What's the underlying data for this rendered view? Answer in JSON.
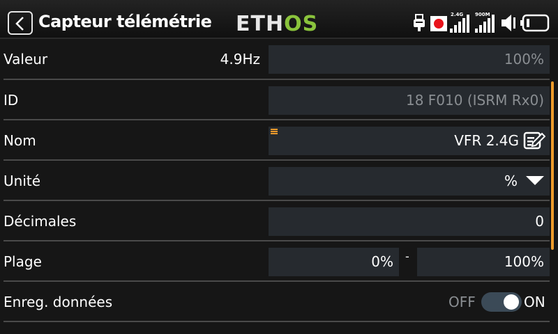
{
  "header": {
    "title": "Capteur télémétrie",
    "logo_part1": "ETH",
    "logo_part2": "OS",
    "signal_2g4": "2.4G",
    "signal_900m": "900M"
  },
  "rows": {
    "valeur": {
      "label": "Valeur",
      "rate": "4.9Hz",
      "value": "100%"
    },
    "id": {
      "label": "ID",
      "value": "18 F010 (ISRM Rx0)"
    },
    "nom": {
      "label": "Nom",
      "value": "VFR 2.4G"
    },
    "unite": {
      "label": "Unité",
      "value": "%"
    },
    "decimales": {
      "label": "Décimales",
      "value": "0"
    },
    "plage": {
      "label": "Plage",
      "min": "0%",
      "dash": "-",
      "max": "100%"
    },
    "enreg": {
      "label": "Enreg. données",
      "off": "OFF",
      "on": "ON",
      "state": "on"
    }
  },
  "colors": {
    "accent": "#ee9b2b",
    "logo_green": "#8ac33c",
    "field_bg": "#262a2f",
    "record_red": "#e8131b"
  }
}
